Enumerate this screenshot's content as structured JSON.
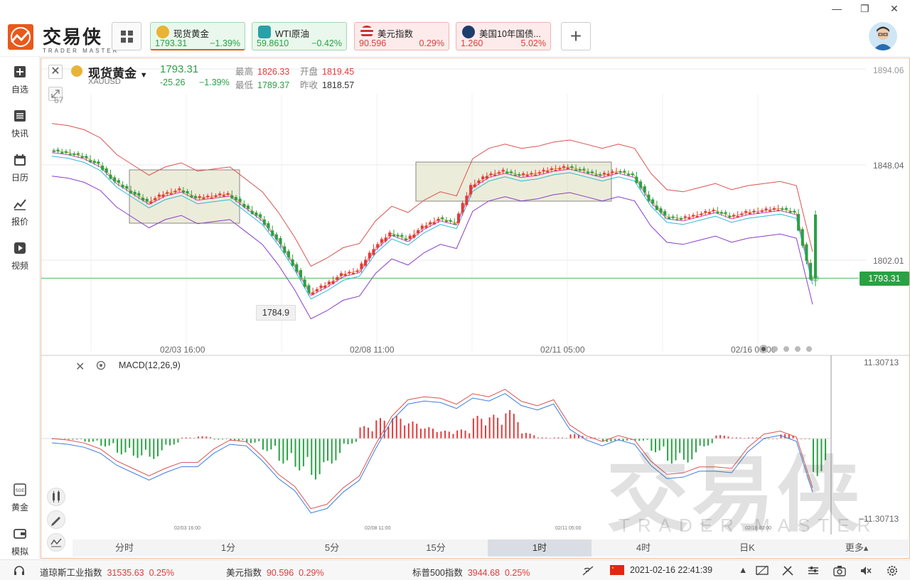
{
  "app": {
    "brand_cn": "交易侠",
    "brand_en": "TRADER MASTER"
  },
  "tickers": [
    {
      "name": "现货黄金",
      "price": "1793.31",
      "change": "−1.39%",
      "dir": "down",
      "icon": "gold-icon"
    },
    {
      "name": "WTI原油",
      "price": "59.8610",
      "change": "−0.42%",
      "dir": "down",
      "icon": "oil-icon"
    },
    {
      "name": "美元指数",
      "price": "90.596",
      "change": "0.29%",
      "dir": "up",
      "icon": "us-flag-icon"
    },
    {
      "name": "美国10年国债...",
      "price": "1.260",
      "change": "5.02%",
      "dir": "up",
      "icon": "bond-icon"
    }
  ],
  "sidebar": [
    {
      "label": "自选",
      "icon": "watchlist-icon"
    },
    {
      "label": "快讯",
      "icon": "news-icon"
    },
    {
      "label": "日历",
      "icon": "calendar-icon"
    },
    {
      "label": "报价",
      "icon": "quote-icon"
    },
    {
      "label": "视频",
      "icon": "video-icon"
    },
    {
      "label": "黄金",
      "icon": "sge-icon"
    },
    {
      "label": "模拟",
      "icon": "simulate-icon"
    }
  ],
  "symbol": {
    "name": "现货黄金",
    "code": "XAUUSD",
    "price": "1793.31",
    "change": "-25.26",
    "change_pct": "−1.39%",
    "high_label": "最高",
    "high": "1826.33",
    "low_label": "最低",
    "low": "1789.37",
    "open_label": "开盘",
    "open": "1819.45",
    "prev_label": "昨收",
    "prev": "1818.57"
  },
  "chart": {
    "y_labels": [
      "1894.06",
      "1848.04",
      "1802.01"
    ],
    "side_value": "67",
    "x_labels": [
      "02/03 16:00",
      "02/08 11:00",
      "02/11 05:00",
      "02/16 00:00"
    ],
    "current_price": "1793.31",
    "min_marker": "1784.9",
    "macd_title": "MACD(12,26,9)",
    "macd_top": "11.30713",
    "macd_bottom": "−11.30713",
    "mini_x_labels": [
      "02/03 16:00",
      "02/08 11:00",
      "02/11 05:00",
      "02/16 00:00"
    ]
  },
  "timeframes": [
    "分时",
    "1分",
    "5分",
    "15分",
    "1时",
    "4时",
    "日K",
    "更多▴"
  ],
  "selected_timeframe": "1时",
  "statusbar": {
    "items": [
      {
        "name": "道琼斯工业指数",
        "value": "31535.63",
        "change": "0.25%"
      },
      {
        "name": "美元指数",
        "value": "90.596",
        "change": "0.29%"
      },
      {
        "name": "标普500指数",
        "value": "3944.68",
        "change": "0.25%"
      }
    ],
    "datetime": "2021-02-16 22:41:39"
  },
  "colors": {
    "up": "#e03b3b",
    "down": "#2aa144",
    "accent": "#e8591a"
  },
  "chart_data": {
    "type": "candlestick",
    "series": [
      {
        "name": "XAUUSD",
        "values": [
          1855,
          1854,
          1852,
          1848,
          1840,
          1835,
          1830,
          1834,
          1836,
          1832,
          1833,
          1834,
          1828,
          1822,
          1812,
          1800,
          1786,
          1790,
          1795,
          1797,
          1808,
          1815,
          1812,
          1818,
          1822,
          1820,
          1838,
          1843,
          1845,
          1843,
          1844,
          1846,
          1847,
          1845,
          1843,
          1845,
          1843,
          1831,
          1823,
          1822,
          1824,
          1826,
          1823,
          1825,
          1826,
          1827,
          1825,
          1793
        ]
      }
    ],
    "macd": {
      "range": [
        -11.30713,
        11.30713
      ]
    }
  }
}
